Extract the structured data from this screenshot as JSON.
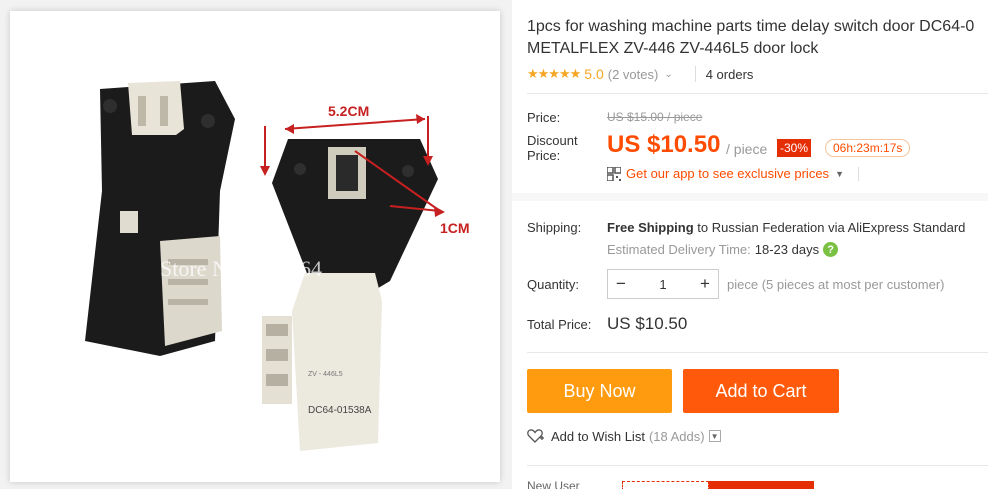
{
  "product": {
    "title_line1": "1pcs for washing machine parts time delay switch door DC64-0",
    "title_line2": "METALFLEX ZV-446 ZV-446L5 door lock",
    "stars": "★★★★★",
    "rating": "5.0",
    "votes": "(2 votes)",
    "orders": "4 orders"
  },
  "image": {
    "dimension_width": "5.2CM",
    "dimension_depth": "1CM",
    "watermark": "Store No:1937764",
    "part_label": "DC64-01538A",
    "model_label": "ZV - 446L5"
  },
  "price": {
    "price_label": "Price:",
    "original": "US $15.00 / piece",
    "discount_label_1": "Discount",
    "discount_label_2": "Price:",
    "current": "US $10.50",
    "per": "/ piece",
    "discount_badge": "-30%",
    "countdown": "06h:23m:17s",
    "app_text": "Get our app to see exclusive prices"
  },
  "shipping": {
    "label": "Shipping:",
    "free": "Free Shipping",
    "to_text": "to Russian Federation via AliExpress Standard",
    "est_label": "Estimated Delivery Time:",
    "est_days": "18-23 days"
  },
  "quantity": {
    "label": "Quantity:",
    "value": "1",
    "note": "piece (5 pieces at most per customer)"
  },
  "total": {
    "label": "Total Price:",
    "value": "US $10.50"
  },
  "actions": {
    "buy_now": "Buy Now",
    "add_to_cart": "Add to Cart",
    "wishlist": "Add to Wish List",
    "wishlist_count": "(18 Adds)",
    "new_user": "New User"
  },
  "colors": {
    "accent_orange": "#ff4c00",
    "buy_now": "#ff9b0f",
    "add_to_cart": "#ff5a0c",
    "star": "#f5a623",
    "discount_red": "#e62e04"
  }
}
